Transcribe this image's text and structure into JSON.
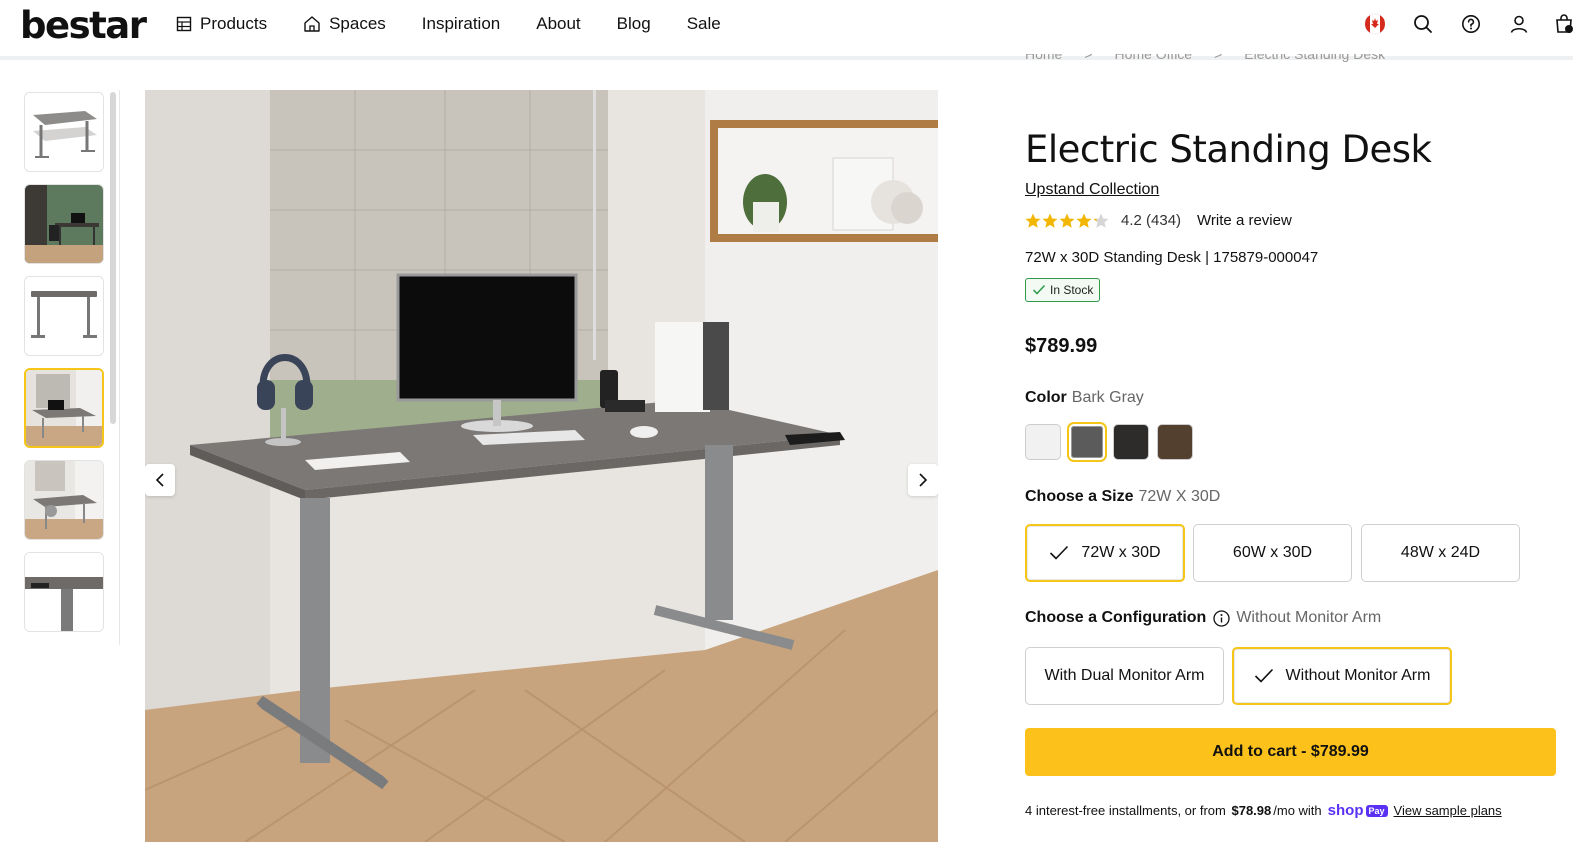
{
  "header": {
    "logo": "bestar",
    "nav": [
      {
        "label": "Products",
        "icon": "grid-icon"
      },
      {
        "label": "Spaces",
        "icon": "home-icon"
      },
      {
        "label": "Inspiration"
      },
      {
        "label": "About"
      },
      {
        "label": "Blog"
      },
      {
        "label": "Sale"
      }
    ],
    "icons": [
      "canada-flag-icon",
      "search-icon",
      "help-icon",
      "account-icon",
      "cart-icon"
    ]
  },
  "breadcrumb": [
    "Home",
    ">",
    "Home Office",
    ">",
    "Electric Standing Desk"
  ],
  "product": {
    "title": "Electric Standing Desk",
    "collection": "Upstand Collection",
    "rating": "4.2 (434)",
    "rating_value": 4.2,
    "write_review": "Write a review",
    "subtitle": "72W x 30D Standing Desk | 175879-000047",
    "stock": "In Stock",
    "price": "$789.99"
  },
  "color": {
    "label": "Color",
    "selected": "Bark Gray",
    "swatches": [
      "#f1f1f1",
      "#5b5b5b",
      "#2d2c2b",
      "#54402f"
    ]
  },
  "size": {
    "label": "Choose a Size",
    "selected": "72W X 30D",
    "options": [
      "72W x 30D",
      "60W x 30D",
      "48W x 24D"
    ]
  },
  "configuration": {
    "label": "Choose a Configuration",
    "selected": "Without Monitor Arm",
    "options": [
      "With Dual Monitor Arm",
      "Without Monitor Arm"
    ]
  },
  "cart": {
    "button": "Add to cart - $789.99"
  },
  "installments": {
    "prefix": "4 interest-free installments, or from",
    "amount": "$78.98",
    "suffix": "/mo with",
    "shop": "shop",
    "pay": "Pay",
    "link": "View sample plans"
  }
}
